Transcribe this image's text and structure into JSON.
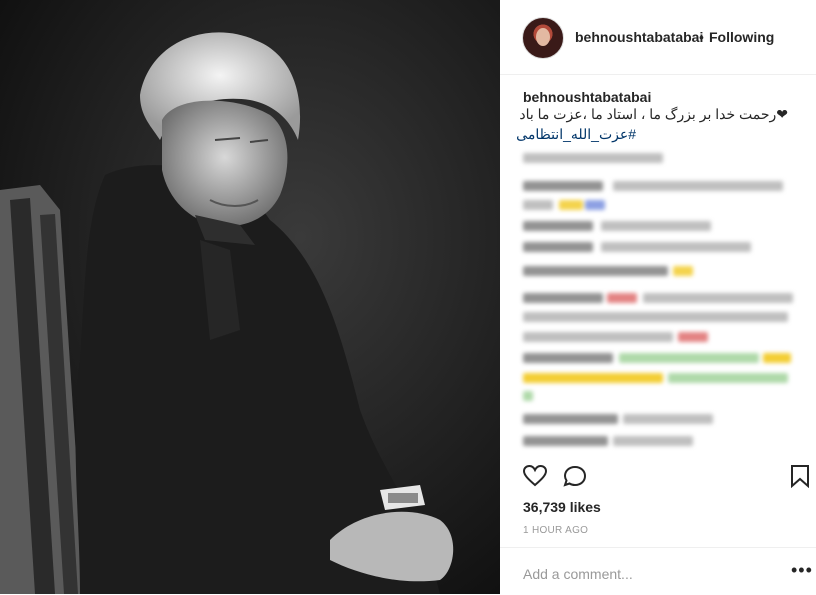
{
  "post": {
    "username": "behnoushtabatabai",
    "follow_separator": "•",
    "follow_status": "Following",
    "caption_username": "behnoushtabatabai",
    "caption_trailing": ".",
    "caption_text": "❤رحمت خدا بر بزرگ ما ، استاد ما ،عزت ما باد",
    "caption_hashtag": "#عزت_الله_انتظامی",
    "likes": "36,739 likes",
    "timestamp": "1 HOUR AGO",
    "comment_placeholder": "Add a comment...",
    "more_icon": "•••"
  },
  "icons": {
    "like": "heart-icon",
    "comment": "comment-icon",
    "save": "bookmark-icon",
    "more": "more-options-icon"
  },
  "colors": {
    "hashtag": "#003569",
    "text": "#262626",
    "muted": "#999999"
  }
}
